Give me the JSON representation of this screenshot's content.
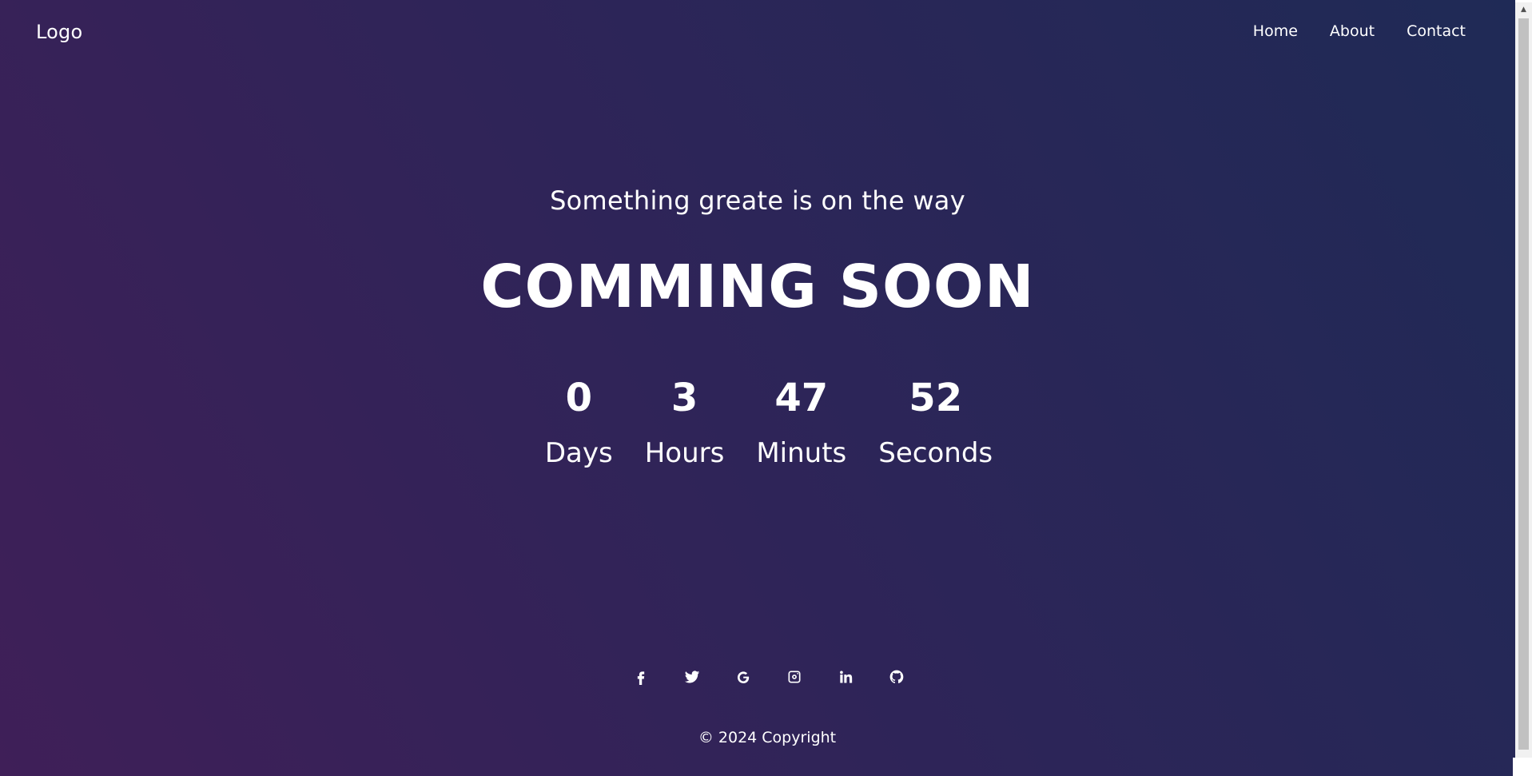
{
  "navbar": {
    "logo": "Logo",
    "links": [
      "Home",
      "About",
      "Contact"
    ]
  },
  "hero": {
    "tagline": "Something greate is on the way",
    "headline": "COMMING SOON"
  },
  "countdown": [
    {
      "value": "0",
      "label": "Days"
    },
    {
      "value": "3",
      "label": "Hours"
    },
    {
      "value": "47",
      "label": "Minuts"
    },
    {
      "value": "52",
      "label": "Seconds"
    }
  ],
  "socials": [
    "facebook-icon",
    "twitter-icon",
    "google-icon",
    "instagram-icon",
    "linkedin-icon",
    "github-icon"
  ],
  "footer": {
    "copyright": "© 2024 Copyright"
  },
  "colors": {
    "gradient_start": "#3f1f58",
    "gradient_end": "#1f2a56",
    "text": "#ffffff"
  }
}
